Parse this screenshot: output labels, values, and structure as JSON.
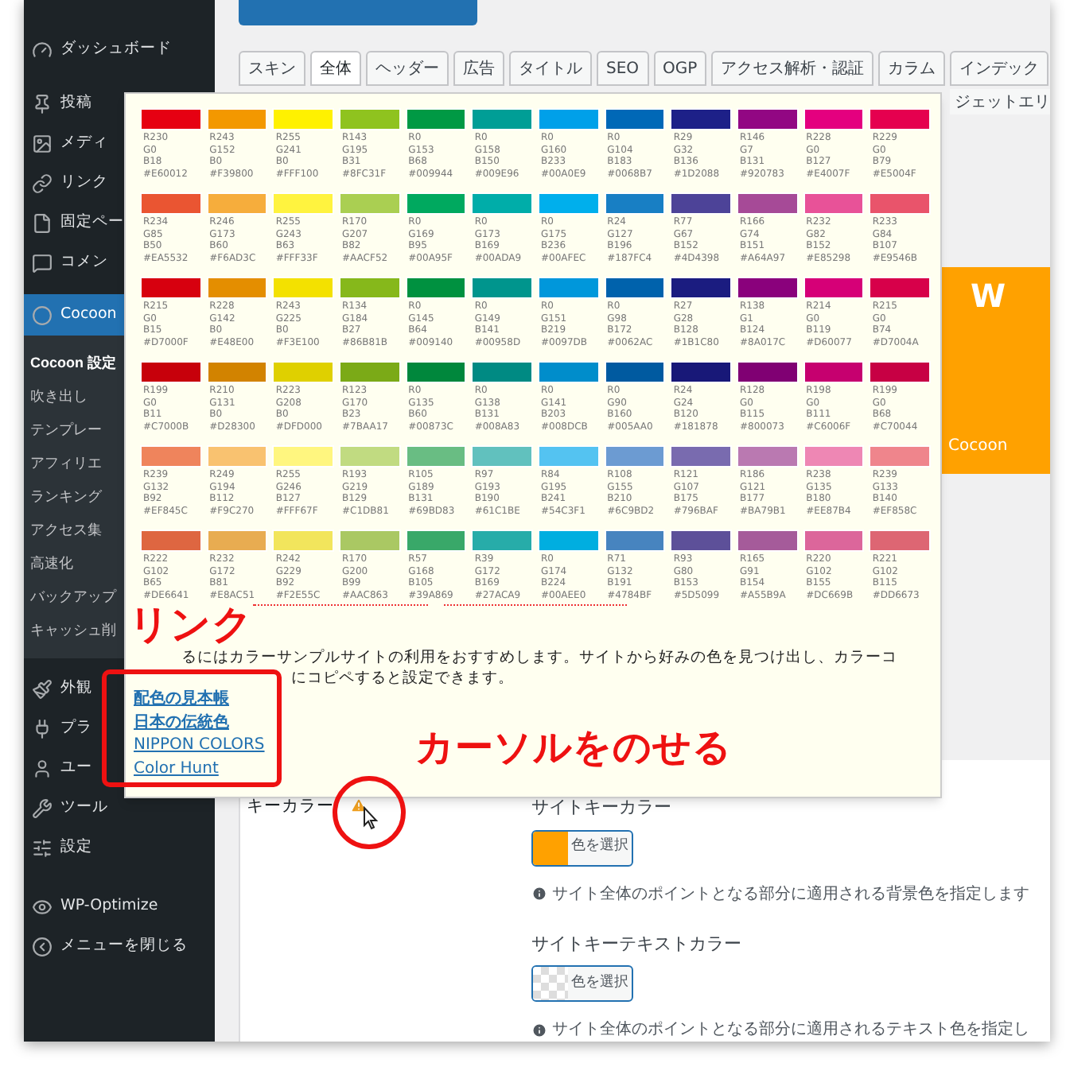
{
  "sidebar": {
    "groups": [
      [
        {
          "label": "ダッシュボード",
          "selected": false
        }
      ],
      [
        {
          "label": "投稿",
          "selected": false
        },
        {
          "label": "メディ",
          "selected": false
        },
        {
          "label": "リンク",
          "selected": false
        },
        {
          "label": "固定ペー",
          "selected": false
        },
        {
          "label": "コメン",
          "selected": false
        }
      ],
      [
        {
          "label": "Cocoon",
          "selected": true,
          "children": [
            {
              "label": "Cocoon 設定",
              "selected": true
            },
            {
              "label": "吹き出し",
              "selected": false
            },
            {
              "label": "テンプレー",
              "selected": false
            },
            {
              "label": "アフィリエ",
              "selected": false
            },
            {
              "label": "ランキング",
              "selected": false
            },
            {
              "label": "アクセス集",
              "selected": false
            },
            {
              "label": "高速化",
              "selected": false
            },
            {
              "label": "バックアップ",
              "selected": false
            },
            {
              "label": "キャッシュ削",
              "selected": false
            }
          ]
        }
      ],
      [
        {
          "label": "外観",
          "selected": false
        },
        {
          "label": "プラ",
          "selected": false
        },
        {
          "label": "ユー",
          "selected": false
        },
        {
          "label": "ツール",
          "selected": false
        },
        {
          "label": "設定",
          "selected": false
        }
      ],
      [
        {
          "label": "WP-Optimize",
          "selected": false
        },
        {
          "label": "メニューを閉じる",
          "selected": false
        }
      ]
    ]
  },
  "tabs": [
    {
      "label": "スキン",
      "selected": false
    },
    {
      "label": "全体",
      "selected": true
    },
    {
      "label": "ヘッダー",
      "selected": false
    },
    {
      "label": "広告",
      "selected": false
    },
    {
      "label": "タイトル",
      "selected": false
    },
    {
      "label": "SEO",
      "selected": false
    },
    {
      "label": "OGP",
      "selected": false
    },
    {
      "label": "アクセス解析・認証",
      "selected": false
    },
    {
      "label": "カラム",
      "selected": false
    },
    {
      "label": "インデック",
      "selected": false
    }
  ],
  "tabs_row_2": [
    "ジェットエリ"
  ],
  "banner": {
    "letter": "W",
    "caption": "Cocoon"
  },
  "color_popup": {
    "rows": [
      [
        {
          "r": "R230",
          "g": "G0",
          "b": "B18",
          "hex": "#E60012",
          "color": "#e60012"
        },
        {
          "r": "R243",
          "g": "G152",
          "b": "B0",
          "hex": "#F39800",
          "color": "#f39800"
        },
        {
          "r": "R255",
          "g": "G241",
          "b": "B0",
          "hex": "#FFF100",
          "color": "#fff100"
        },
        {
          "r": "R143",
          "g": "G195",
          "b": "B31",
          "hex": "#8FC31F",
          "color": "#8fc31f"
        },
        {
          "r": "R0",
          "g": "G153",
          "b": "B68",
          "hex": "#009944",
          "color": "#009944"
        },
        {
          "r": "R0",
          "g": "G158",
          "b": "B150",
          "hex": "#009E96",
          "color": "#009e96"
        },
        {
          "r": "R0",
          "g": "G160",
          "b": "B233",
          "hex": "#00A0E9",
          "color": "#00a0e9"
        },
        {
          "r": "R0",
          "g": "G104",
          "b": "B183",
          "hex": "#0068B7",
          "color": "#0068b7"
        },
        {
          "r": "R29",
          "g": "G32",
          "b": "B136",
          "hex": "#1D2088",
          "color": "#1d2088"
        },
        {
          "r": "R146",
          "g": "G7",
          "b": "B131",
          "hex": "#920783",
          "color": "#920783"
        },
        {
          "r": "R228",
          "g": "G0",
          "b": "B127",
          "hex": "#E4007F",
          "color": "#e4007f"
        },
        {
          "r": "R229",
          "g": "G0",
          "b": "B79",
          "hex": "#E5004F",
          "color": "#e5004f"
        }
      ],
      [
        {
          "r": "R234",
          "g": "G85",
          "b": "B50",
          "hex": "#EA5532",
          "color": "#ea5532"
        },
        {
          "r": "R246",
          "g": "G173",
          "b": "B60",
          "hex": "#F6AD3C",
          "color": "#f6ad3c"
        },
        {
          "r": "R255",
          "g": "G243",
          "b": "B63",
          "hex": "#FFF33F",
          "color": "#fff33f"
        },
        {
          "r": "R170",
          "g": "G207",
          "b": "B82",
          "hex": "#AACF52",
          "color": "#aacf52"
        },
        {
          "r": "R0",
          "g": "G169",
          "b": "B95",
          "hex": "#00A95F",
          "color": "#00a95f"
        },
        {
          "r": "R0",
          "g": "G173",
          "b": "B169",
          "hex": "#00ADA9",
          "color": "#00ada9"
        },
        {
          "r": "R0",
          "g": "G175",
          "b": "B236",
          "hex": "#00AFEC",
          "color": "#00afec"
        },
        {
          "r": "R24",
          "g": "G127",
          "b": "B196",
          "hex": "#187FC4",
          "color": "#187fc4"
        },
        {
          "r": "R77",
          "g": "G67",
          "b": "B152",
          "hex": "#4D4398",
          "color": "#4d4398"
        },
        {
          "r": "R166",
          "g": "G74",
          "b": "B151",
          "hex": "#A64A97",
          "color": "#a64a97"
        },
        {
          "r": "R232",
          "g": "G82",
          "b": "B152",
          "hex": "#E85298",
          "color": "#e85298"
        },
        {
          "r": "R233",
          "g": "G84",
          "b": "B107",
          "hex": "#E9546B",
          "color": "#e9546b"
        }
      ],
      [
        {
          "r": "R215",
          "g": "G0",
          "b": "B15",
          "hex": "#D7000F",
          "color": "#d7000f"
        },
        {
          "r": "R228",
          "g": "G142",
          "b": "B0",
          "hex": "#E48E00",
          "color": "#e48e00"
        },
        {
          "r": "R243",
          "g": "G225",
          "b": "B0",
          "hex": "#F3E100",
          "color": "#f3e100"
        },
        {
          "r": "R134",
          "g": "G184",
          "b": "B27",
          "hex": "#86B81B",
          "color": "#86b81b"
        },
        {
          "r": "R0",
          "g": "G145",
          "b": "B64",
          "hex": "#009140",
          "color": "#009140"
        },
        {
          "r": "R0",
          "g": "G149",
          "b": "B141",
          "hex": "#00958D",
          "color": "#00958d"
        },
        {
          "r": "R0",
          "g": "G151",
          "b": "B219",
          "hex": "#0097DB",
          "color": "#0097db"
        },
        {
          "r": "R0",
          "g": "G98",
          "b": "B172",
          "hex": "#0062AC",
          "color": "#0062ac"
        },
        {
          "r": "R27",
          "g": "G28",
          "b": "B128",
          "hex": "#1B1C80",
          "color": "#1b1c80"
        },
        {
          "r": "R138",
          "g": "G1",
          "b": "B124",
          "hex": "#8A017C",
          "color": "#8a017c"
        },
        {
          "r": "R214",
          "g": "G0",
          "b": "B119",
          "hex": "#D60077",
          "color": "#d60077"
        },
        {
          "r": "R215",
          "g": "G0",
          "b": "B74",
          "hex": "#D7004A",
          "color": "#d7004a"
        }
      ],
      [
        {
          "r": "R199",
          "g": "G0",
          "b": "B11",
          "hex": "#C7000B",
          "color": "#c7000b"
        },
        {
          "r": "R210",
          "g": "G131",
          "b": "B0",
          "hex": "#D28300",
          "color": "#d28300"
        },
        {
          "r": "R223",
          "g": "G208",
          "b": "B0",
          "hex": "#DFD000",
          "color": "#dfd000"
        },
        {
          "r": "R123",
          "g": "G170",
          "b": "B23",
          "hex": "#7BAA17",
          "color": "#7baa17"
        },
        {
          "r": "R0",
          "g": "G135",
          "b": "B60",
          "hex": "#00873C",
          "color": "#00873c"
        },
        {
          "r": "R0",
          "g": "G138",
          "b": "B131",
          "hex": "#008A83",
          "color": "#008a83"
        },
        {
          "r": "R0",
          "g": "G141",
          "b": "B203",
          "hex": "#008DCB",
          "color": "#008dcb"
        },
        {
          "r": "R0",
          "g": "G90",
          "b": "B160",
          "hex": "#005AA0",
          "color": "#005aa0"
        },
        {
          "r": "R24",
          "g": "G24",
          "b": "B120",
          "hex": "#181878",
          "color": "#181878"
        },
        {
          "r": "R128",
          "g": "G0",
          "b": "B115",
          "hex": "#800073",
          "color": "#800073"
        },
        {
          "r": "R198",
          "g": "G0",
          "b": "B111",
          "hex": "#C6006F",
          "color": "#c6006f"
        },
        {
          "r": "R199",
          "g": "G0",
          "b": "B68",
          "hex": "#C70044",
          "color": "#c70044"
        }
      ],
      [
        {
          "r": "R239",
          "g": "G132",
          "b": "B92",
          "hex": "#EF845C",
          "color": "#ef845c"
        },
        {
          "r": "R249",
          "g": "G194",
          "b": "B112",
          "hex": "#F9C270",
          "color": "#f9c270"
        },
        {
          "r": "R255",
          "g": "G246",
          "b": "B127",
          "hex": "#FFF67F",
          "color": "#fff67f"
        },
        {
          "r": "R193",
          "g": "G219",
          "b": "B129",
          "hex": "#C1DB81",
          "color": "#c1db81"
        },
        {
          "r": "R105",
          "g": "G189",
          "b": "B131",
          "hex": "#69BD83",
          "color": "#69bd83"
        },
        {
          "r": "R97",
          "g": "G193",
          "b": "B190",
          "hex": "#61C1BE",
          "color": "#61c1be"
        },
        {
          "r": "R84",
          "g": "G195",
          "b": "B241",
          "hex": "#54C3F1",
          "color": "#54c3f1"
        },
        {
          "r": "R108",
          "g": "G155",
          "b": "B210",
          "hex": "#6C9BD2",
          "color": "#6c9bd2"
        },
        {
          "r": "R121",
          "g": "G107",
          "b": "B175",
          "hex": "#796BAF",
          "color": "#796baf"
        },
        {
          "r": "R186",
          "g": "G121",
          "b": "B177",
          "hex": "#BA79B1",
          "color": "#ba79b1"
        },
        {
          "r": "R238",
          "g": "G135",
          "b": "B180",
          "hex": "#EE87B4",
          "color": "#ee87b4"
        },
        {
          "r": "R239",
          "g": "G133",
          "b": "B140",
          "hex": "#EF858C",
          "color": "#ef858c"
        }
      ],
      [
        {
          "r": "R222",
          "g": "G102",
          "b": "B65",
          "hex": "#DE6641",
          "color": "#de6641"
        },
        {
          "r": "R232",
          "g": "G172",
          "b": "B81",
          "hex": "#E8AC51",
          "color": "#e8ac51"
        },
        {
          "r": "R242",
          "g": "G229",
          "b": "B92",
          "hex": "#F2E55C",
          "color": "#f2e55c"
        },
        {
          "r": "R170",
          "g": "G200",
          "b": "B99",
          "hex": "#AAC863",
          "color": "#aac863"
        },
        {
          "r": "R57",
          "g": "G168",
          "b": "B105",
          "hex": "#39A869",
          "color": "#39a869"
        },
        {
          "r": "R39",
          "g": "G172",
          "b": "B169",
          "hex": "#27ACA9",
          "color": "#27aca9"
        },
        {
          "r": "R0",
          "g": "G174",
          "b": "B224",
          "hex": "#00AEE0",
          "color": "#00aee0"
        },
        {
          "r": "R71",
          "g": "G132",
          "b": "B191",
          "hex": "#4784BF",
          "color": "#4784bf"
        },
        {
          "r": "R93",
          "g": "G80",
          "b": "B153",
          "hex": "#5D5099",
          "color": "#5d5099"
        },
        {
          "r": "R165",
          "g": "G91",
          "b": "B154",
          "hex": "#A55B9A",
          "color": "#a55b9a"
        },
        {
          "r": "R220",
          "g": "G102",
          "b": "B155",
          "hex": "#DC669B",
          "color": "#dc669b"
        },
        {
          "r": "R221",
          "g": "G102",
          "b": "B115",
          "hex": "#DD6673",
          "color": "#dd6673"
        }
      ]
    ],
    "description": [
      "るにはカラーサンプルサイトの利用をおすすめします。サイトから好みの色を見つけ出し、カラーコ",
      "にコピペすると設定できます。"
    ],
    "links": [
      "配色の見本帳",
      "日本の伝統色",
      "NIPPON COLORS",
      "Color Hunt"
    ]
  },
  "settings": {
    "label": "キーカラー",
    "fields": [
      {
        "title": "サイトキーカラー",
        "kind": "solid",
        "color": "#ffa100",
        "button": "色を選択",
        "note": "サイト全体のポイントとなる部分に適用される背景色を指定します"
      },
      {
        "title": "サイトキーテキストカラー",
        "kind": "empty",
        "button": "色を選択",
        "note": "サイト全体のポイントとなる部分に適用されるテキスト色を指定し"
      }
    ]
  },
  "annotations": [
    {
      "kind": "callout",
      "text": "リンク"
    },
    {
      "kind": "callout",
      "text": "カーソルをのせる"
    }
  ]
}
